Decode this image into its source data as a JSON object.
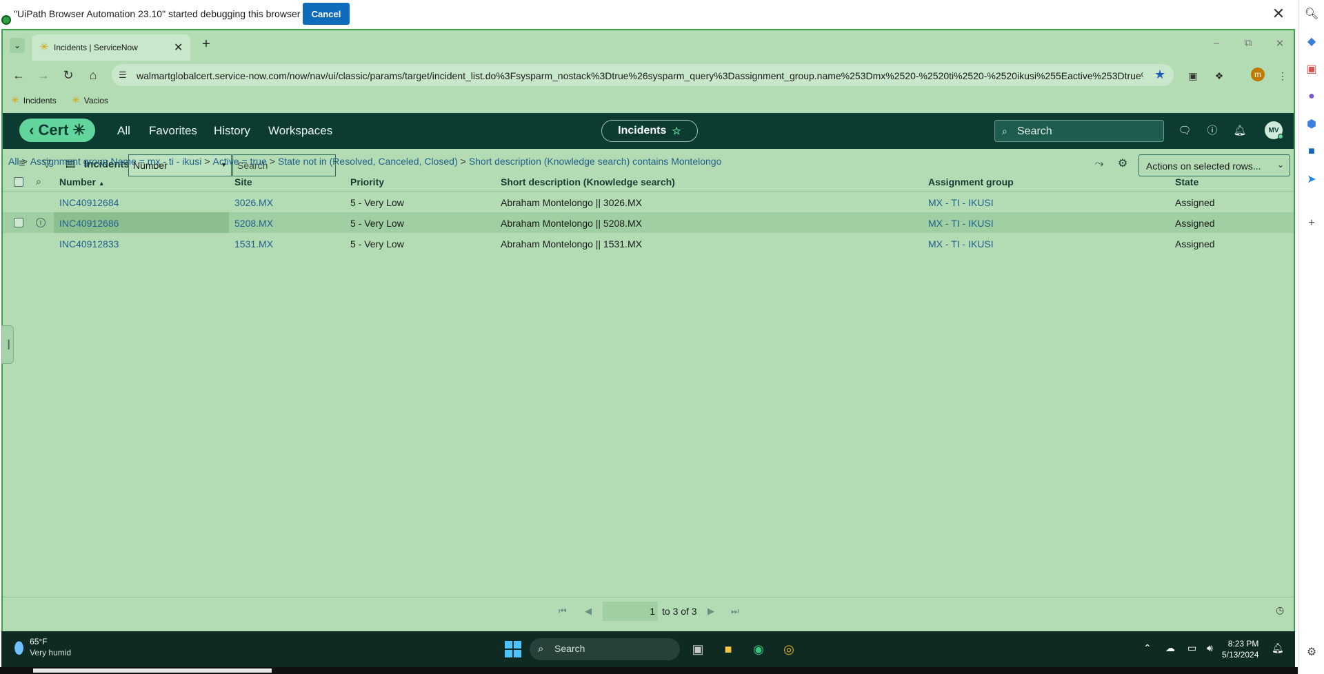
{
  "banner": {
    "message": "\"UiPath Browser Automation 23.10\" started debugging this browser",
    "cancel_label": "Cancel",
    "close_glyph": "✕"
  },
  "browser": {
    "tab_title": "Incidents | ServiceNow",
    "url": "walmartglobalcert.service-now.com/now/nav/ui/classic/params/target/incident_list.do%3Fsysparm_nostack%3Dtrue%26sysparm_query%3Dassignment_group.name%253Dmx%2520-%2520ti%2520-%2520ikusi%255Eactive%253Dtrue%2...",
    "profile_initial": "m",
    "bookmarks": [
      {
        "label": "Incidents",
        "icon": "walmart-spark-icon"
      },
      {
        "label": "Vacios",
        "icon": "walmart-spark-icon"
      }
    ]
  },
  "servicenow": {
    "logo_text": "Cert",
    "nav": [
      "All",
      "Favorites",
      "History",
      "Workspaces"
    ],
    "context_label": "Incidents",
    "search_placeholder": "Search",
    "avatar_initials": "MV"
  },
  "list": {
    "title": "Incidents",
    "field_select": "Number",
    "search_placeholder": "Search",
    "actions_label": "Actions on selected rows...",
    "breadcrumb": [
      "All",
      "Assignment group Name = mx - ti - ikusi",
      "Active = true",
      "State not in (Resolved, Canceled, Closed)",
      "Short description (Knowledge search) contains Montelongo"
    ],
    "columns": [
      "Number",
      "Site",
      "Priority",
      "Short description (Knowledge search)",
      "Assignment group",
      "State"
    ],
    "rows": [
      {
        "number": "INC40912684",
        "site": "3026.MX",
        "priority": "5 - Very Low",
        "short_description": "Abraham Montelongo || 3026.MX",
        "assignment_group": "MX - TI - IKUSI",
        "state": "Assigned"
      },
      {
        "number": "INC40912686",
        "site": "5208.MX",
        "priority": "5 - Very Low",
        "short_description": "Abraham Montelongo || 5208.MX",
        "assignment_group": "MX - TI - IKUSI",
        "state": "Assigned"
      },
      {
        "number": "INC40912833",
        "site": "1531.MX",
        "priority": "5 - Very Low",
        "short_description": "Abraham Montelongo || 1531.MX",
        "assignment_group": "MX - TI - IKUSI",
        "state": "Assigned"
      }
    ],
    "pagination": {
      "page": "1",
      "range_text": "to 3 of 3"
    }
  },
  "taskbar": {
    "temperature": "65°F",
    "weather_desc": "Very humid",
    "search_placeholder": "Search",
    "time": "8:23 PM",
    "date": "5/13/2024"
  },
  "colors": {
    "sn_header": "#0b3b31",
    "page_bg": "#b3dcb5",
    "link": "#1f5f8c",
    "accent": "#62d59c"
  }
}
